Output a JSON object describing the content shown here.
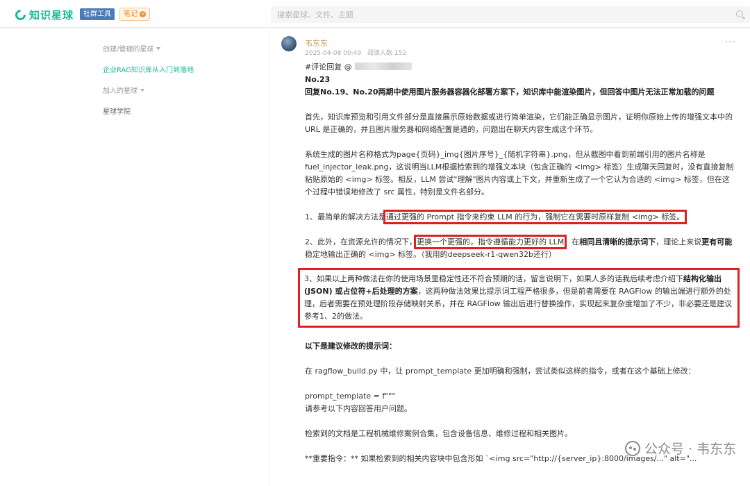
{
  "header": {
    "brand": "知识星球",
    "tool_tag": "社群工具",
    "note_tag": "笔记",
    "search_placeholder": "搜索星球、文件、主题"
  },
  "sidebar": {
    "items": [
      {
        "label": "创建/管理的星球"
      },
      {
        "label": "企业RAG知识库从入门到落地"
      },
      {
        "label": "加入的星球"
      },
      {
        "label": "星球学院"
      }
    ]
  },
  "post": {
    "author": "韦东东",
    "timestamp": "2025-04-08 00:49",
    "read_count": "阅读人数 152",
    "mention": "#评论回复 @",
    "number": "No.23",
    "headline": "回复No.19、No.20两期中使用图片服务器容器化部署方案下，知识库中能渲染图片，但回答中图片无法正常加载的问题",
    "p1": "首先，知识库预览和引用文件部分是直接展示原始数据或进行简单渲染，它们能正确显示图片，证明你原始上传的增强文本中的 URL 是正确的，并且图片服务器和网络配置是通的，问题出在聊天内容生成这个环节。",
    "p2": "系统生成的图片名称格式为page{页码}_img{图片序号}_{随机字符串}.png，但从截图中看到前端引用的图片名称是fuel_injector_leak.png，这说明当LLM根据检索到的增强文本块（包含正确的 <img> 标签）生成聊天回复时，没有直接复制粘贴原始的 <img> 标签。相反，LLM 尝试\"理解\"图片内容或上下文，并重新生成了一个它认为合适的 <img> 标签，但在这个过程中错误地修改了 src 属性，特别是文件名部分。",
    "p3_prefix": "1、最简单的解决方法是",
    "p3_box": "通过更强的 Prompt 指令来约束 LLM 的行为，强制它在需要时原样复制 <img> 标签。",
    "p4_prefix": "2、此外，在资源允许的情况下，",
    "p4_box": "更换一个更强的，指令遵循能力更好的 LLM",
    "p4_mid": "，在",
    "p4_bold": "相同且清晰的提示词下",
    "p4_mid2": "，理论上来说",
    "p4_bold2": "更有可能",
    "p4_suffix": "稳定地输出正确的 <img> 标签。（我用的deepseek-r1-qwen32b还行）",
    "p5_prefix": "3、如果以上两种做法在你的使用场景里稳定性还不符合预期的话，留言说明下，如果人多的话我后续考虑介绍下",
    "p5_bold": "结构化输出 (JSON) 或占位符+后处理的方案",
    "p5_suffix": "，这两种做法效果比提示词工程严格很多，但是前者需要在 RAGFlow 的输出端进行额外的处理，后者需要在预处理阶段存储映射关系，并在 RAGFlow 输出后进行替换操作，实现起来复杂度增加了不少，非必要还是建议参考1、2的做法。",
    "section_title": "以下是建议修改的提示词：",
    "p6": "在 ragflow_build.py 中，让 prompt_template 更加明确和强制，尝试类似这样的指令，或者在这个基础上修改：",
    "code1": "prompt_template = f\"\"\"",
    "code2": "请参考以下内容回答用户问题。",
    "p7": "检索到的文档是工程机械维修案例合集，包含设备信息、维修过程和相关图片。",
    "p8": "**重要指令：** 如果检索到的相关内容块中包含形如 `<img src=\"http://{server_ip}:8000/images/...\" alt=\"..."
  },
  "watermark": {
    "text": "公众号 · 韦东东"
  },
  "colors": {
    "brand": "#16b998",
    "highlight_box": "#e02020",
    "author": "#c89a5a"
  }
}
